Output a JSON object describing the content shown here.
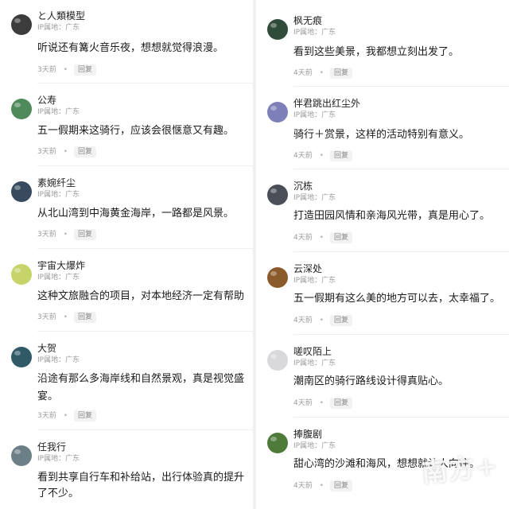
{
  "left": [
    {
      "user": "と人類模型",
      "ip": "IP属地：广东",
      "text": [
        "听说还有篝火音乐夜，想想就觉得浪漫。"
      ],
      "time": "3天前",
      "reply": "回复",
      "avatar": "#3c3c3c"
    },
    {
      "user": "公寿",
      "ip": "IP属地：广东",
      "text": [
        "五一假期来这骑行，应该会很惬意又有趣。"
      ],
      "time": "3天前",
      "reply": "回复",
      "avatar": "#4f8a5a"
    },
    {
      "user": "素婉纤尘",
      "ip": "IP属地：广东",
      "text": [
        "从北山湾到中海黄金海岸，一路都是风景。"
      ],
      "time": "3天前",
      "reply": "回复",
      "avatar": "#3a4a5e"
    },
    {
      "user": "宇宙大爆炸",
      "ip": "IP属地：广东",
      "text": [
        "这种文旅融合的项目，对本地经济一定有帮助"
      ],
      "time": "3天前",
      "reply": "回复",
      "avatar": "#c7d46a"
    },
    {
      "user": "大贺",
      "ip": "IP属地：广东",
      "text": [
        "沿途有那么多海岸线和自然景观，真是视觉盛",
        "宴。"
      ],
      "time": "3天前",
      "reply": "回复",
      "avatar": "#2f5a66"
    },
    {
      "user": "任我行",
      "ip": "IP属地：广东",
      "text": [
        "看到共享自行车和补给站，出行体验真的提升",
        "了不少。"
      ],
      "time": "",
      "reply": "",
      "avatar": "#6c7f86"
    }
  ],
  "right": [
    {
      "user": "枫无痕",
      "ip": "IP属地：广东",
      "text": [
        "看到这些美景，我都想立刻出发了。"
      ],
      "time": "4天前",
      "reply": "回复",
      "avatar": "#2f4b3a"
    },
    {
      "user": "伴君跳出红尘外",
      "ip": "IP属地：广东",
      "text": [
        "骑行＋赏景，这样的活动特别有意义。"
      ],
      "time": "4天前",
      "reply": "回复",
      "avatar": "#7d7fb8"
    },
    {
      "user": "沉栋",
      "ip": "IP属地：广东",
      "text": [
        "打造田园风情和亲海风光带，真是用心了。"
      ],
      "time": "4天前",
      "reply": "回复",
      "avatar": "#4a4f57"
    },
    {
      "user": "云深处",
      "ip": "IP属地：广东",
      "text": [
        "五一假期有这么美的地方可以去，太幸福了。"
      ],
      "time": "4天前",
      "reply": "回复",
      "avatar": "#8a5a2a"
    },
    {
      "user": "嗟叹陌上",
      "ip": "IP属地：广东",
      "text": [
        "潮南区的骑行路线设计得真贴心。"
      ],
      "time": "4天前",
      "reply": "回复",
      "avatar": "#d9d9dc"
    },
    {
      "user": "捧腹剧",
      "ip": "IP属地：广东",
      "text": [
        "甜心湾的沙滩和海风，想想就让人向往。"
      ],
      "time": "4天前",
      "reply": "回复",
      "avatar": "#4e7a3a"
    }
  ],
  "watermark": "南方+",
  "colors": {
    "panel": "#ffffff",
    "gap": "#f0f0f0",
    "text": "#1a1a1a",
    "muted": "#9a9a9a"
  }
}
